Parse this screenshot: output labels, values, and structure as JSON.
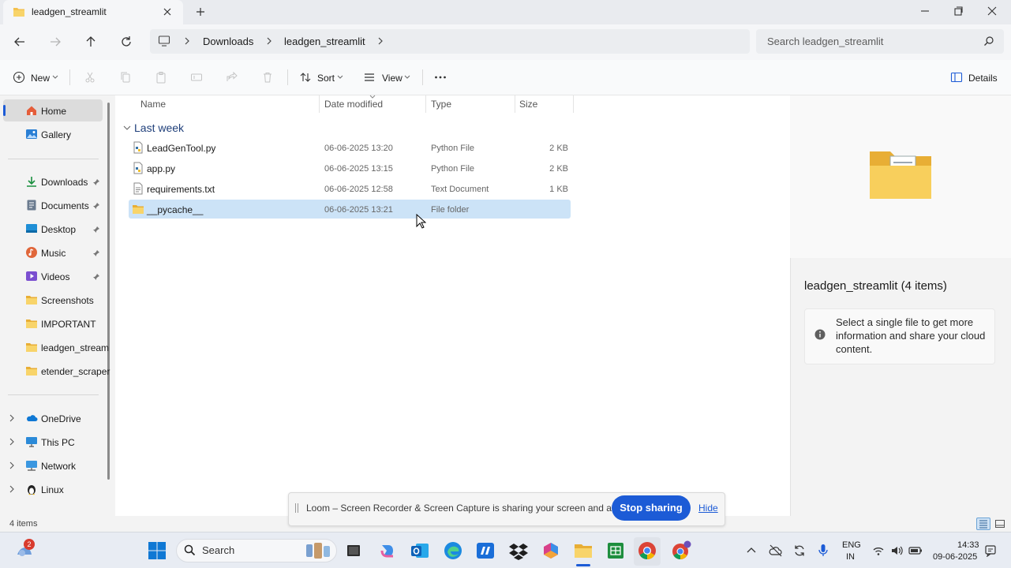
{
  "tab": {
    "title": "leadgen_streamlit"
  },
  "breadcrumb": {
    "items": [
      "Downloads",
      "leadgen_streamlit"
    ]
  },
  "search": {
    "placeholder": "Search leadgen_streamlit"
  },
  "commandbar": {
    "new_label": "New",
    "sort_label": "Sort",
    "view_label": "View",
    "details_label": "Details"
  },
  "nav": {
    "items": [
      {
        "label": "Home",
        "icon": "home-icon",
        "selected": true
      },
      {
        "label": "Gallery",
        "icon": "gallery-icon"
      },
      {
        "label": "Downloads",
        "icon": "download-icon",
        "pinned": true
      },
      {
        "label": "Documents",
        "icon": "documents-icon",
        "pinned": true
      },
      {
        "label": "Desktop",
        "icon": "desktop-icon",
        "pinned": true
      },
      {
        "label": "Music",
        "icon": "music-icon",
        "pinned": true
      },
      {
        "label": "Videos",
        "icon": "videos-icon",
        "pinned": true
      },
      {
        "label": "Screenshots",
        "icon": "folder-icon"
      },
      {
        "label": "IMPORTANT",
        "icon": "folder-icon"
      },
      {
        "label": "leadgen_stream",
        "icon": "folder-icon"
      },
      {
        "label": "etender_scraper",
        "icon": "folder-icon"
      },
      {
        "label": "OneDrive",
        "icon": "onedrive-icon"
      },
      {
        "label": "This PC",
        "icon": "pc-icon"
      },
      {
        "label": "Network",
        "icon": "network-icon"
      },
      {
        "label": "Linux",
        "icon": "linux-icon"
      }
    ]
  },
  "filelist": {
    "columns": [
      "Name",
      "Date modified",
      "Type",
      "Size"
    ],
    "group_label": "Last week",
    "rows": [
      {
        "name": "LeadGenTool.py",
        "date": "06-06-2025 13:20",
        "type": "Python File",
        "size": "2 KB",
        "icon": "python-file-icon"
      },
      {
        "name": "app.py",
        "date": "06-06-2025 13:15",
        "type": "Python File",
        "size": "2 KB",
        "icon": "python-file-icon"
      },
      {
        "name": "requirements.txt",
        "date": "06-06-2025 12:58",
        "type": "Text Document",
        "size": "1 KB",
        "icon": "text-file-icon"
      },
      {
        "name": "__pycache__",
        "date": "06-06-2025 13:21",
        "type": "File folder",
        "size": "",
        "icon": "folder-icon",
        "selected": true
      }
    ]
  },
  "details": {
    "title": "leadgen_streamlit (4 items)",
    "message": "Select a single file to get more information and share your cloud content."
  },
  "status": {
    "count": "4 items"
  },
  "loom": {
    "text": "Loom – Screen Recorder & Screen Capture is sharing your screen and audio.",
    "stop_label": "Stop sharing",
    "hide_label": "Hide"
  },
  "taskbar": {
    "search_label": "Search",
    "widget_badge": "2",
    "lang_line1": "ENG",
    "lang_line2": "IN",
    "time": "14:33",
    "date": "09-06-2025"
  },
  "colors": {
    "accent": "#1c5bd6",
    "folder": "#f4c14e",
    "selected_row": "#cce3f7",
    "nav_selected": "#dcdcdc"
  }
}
